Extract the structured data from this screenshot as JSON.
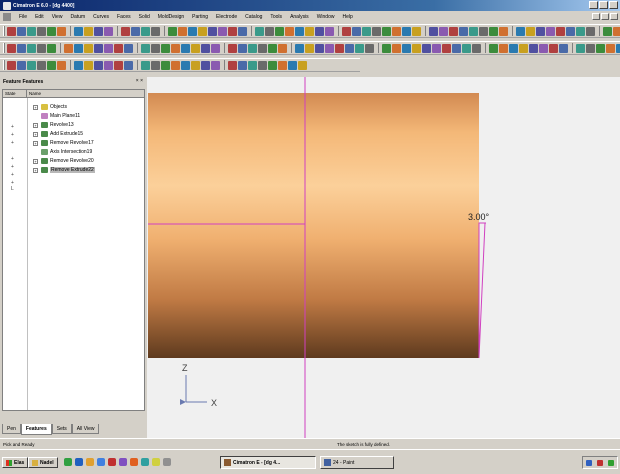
{
  "window": {
    "title": "Cimatron E 6.0 - [dg 4400]"
  },
  "menu": {
    "items": [
      "File",
      "Edit",
      "View",
      "Datum",
      "Curves",
      "Faces",
      "Solid",
      "MoldDesign",
      "Parting",
      "Electrode",
      "Catalog",
      "Tools",
      "Analysis",
      "Window",
      "Help"
    ]
  },
  "feature_panel": {
    "title": "Feature Features",
    "close_glyph": "× ×",
    "columns": [
      "State",
      "Name"
    ],
    "items": [
      {
        "label": "Objects",
        "icon_color": "#d8c040"
      },
      {
        "label": "Main Plane11",
        "icon_color": "#c080c0"
      },
      {
        "label": "Revolve13",
        "icon_color": "#4a8a4a"
      },
      {
        "label": "Add Extrude15",
        "icon_color": "#4a8a4a"
      },
      {
        "label": "Remove Revolve17",
        "icon_color": "#4a8a4a"
      },
      {
        "label": "Axis Intersection19",
        "icon_color": "#6aa06a"
      },
      {
        "label": "Remove Revolve20",
        "icon_color": "#4a8a4a"
      },
      {
        "label": "Remove Extrude22",
        "icon_color": "#4a8a4a"
      }
    ],
    "state_marks": [
      "+",
      "+",
      "+",
      "+",
      "+",
      "+",
      "+ L"
    ],
    "tabs": [
      "Pen",
      "Features",
      "Sets",
      "All View"
    ],
    "active_tab": "Features"
  },
  "viewport": {
    "dimension_label": "3.00°",
    "axis_z": "Z",
    "axis_x": "X"
  },
  "status": {
    "left": "Pick and Ready",
    "center": "The sketch is fully defined."
  },
  "taskbar": {
    "start_label": "Elas",
    "folder_label": "Nadel",
    "tasks": [
      "Cimatron E - [dg 4...",
      "24 - Paint"
    ],
    "active_task": 0
  },
  "colors": {
    "title_bar": "#0a246a",
    "part_light": "#fbd09a",
    "part_dark": "#5e3a1e",
    "sketch_line": "#d040c0",
    "axis_line": "#6a7ab0"
  }
}
